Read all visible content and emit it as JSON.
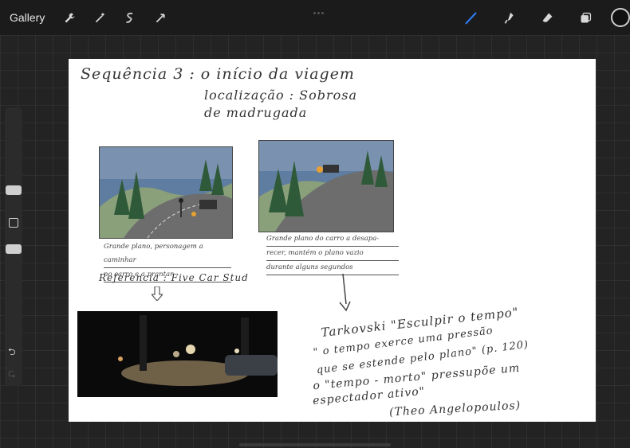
{
  "toolbar": {
    "gallery_label": "Gallery",
    "left_tools": [
      "wrench-icon",
      "magic-wand-icon",
      "selection-icon",
      "transform-icon"
    ],
    "right_tools": [
      "brush-icon",
      "smudge-icon",
      "eraser-icon",
      "layers-icon"
    ],
    "active_color": "#111111",
    "accent": "#2f7df6"
  },
  "sidebar": {
    "brush_size": 0.35,
    "opacity": 0.62
  },
  "canvas": {
    "title_line1": "Sequência 3 : o início da viagem",
    "title_line2": "localização : Sobrosa",
    "title_line3": "de madrugada",
    "panel1_caption": [
      "Grande plano, personagem a caminhar",
      "no carro e a prantar"
    ],
    "panel2_caption": [
      "Grande plano do carro a desapa-",
      "recer, mantém o plano vazio",
      "durante alguns segundos"
    ],
    "reference": "Referencia : Five Car Stud",
    "note1": "Tarkovski \"Esculpir o tempo\"",
    "note2": "\" o tempo exerce uma pressão",
    "note3": "que se estende pelo plano\" (p. 120)",
    "note4": "o \"tempo - morto\" pressupõe um",
    "note5": "espectador ativo\"",
    "note6": "(Theo Angelopoulos)"
  }
}
